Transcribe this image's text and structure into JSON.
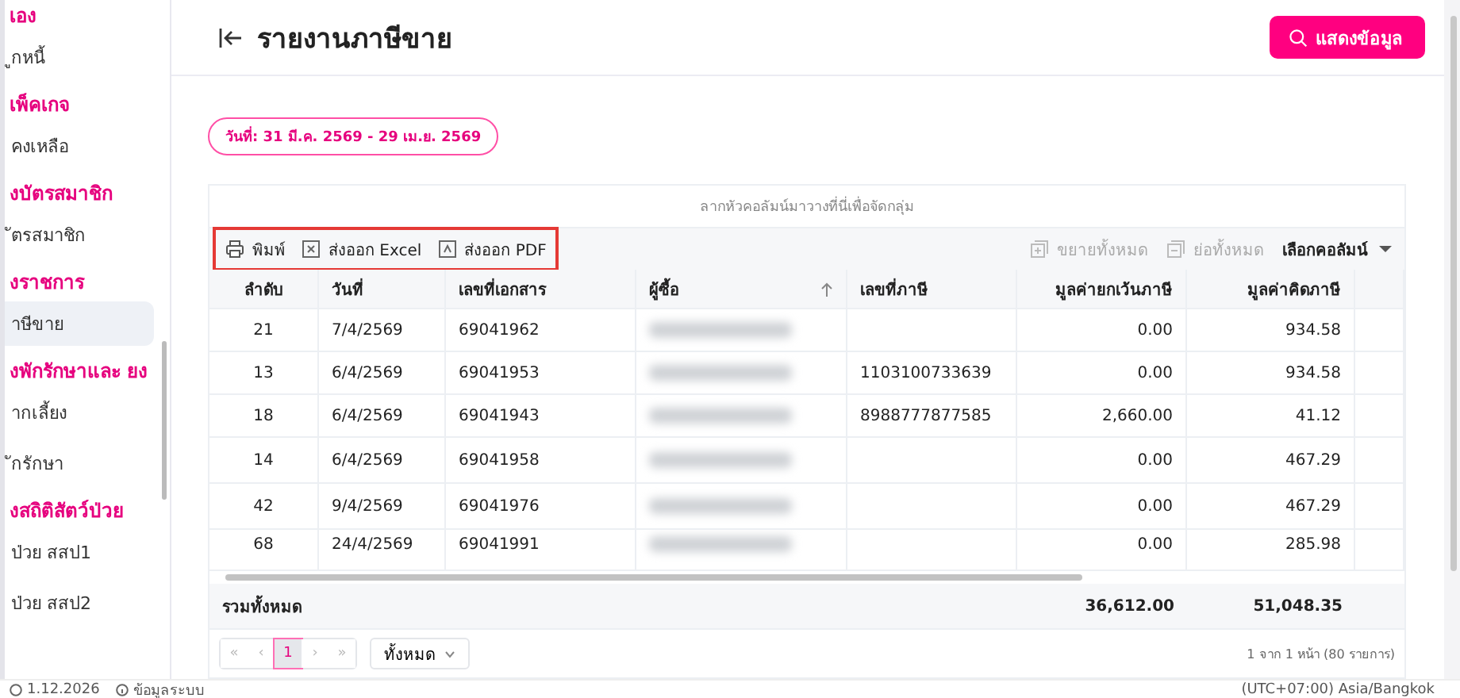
{
  "sidebar": {
    "sections": [
      {
        "title": "เอง",
        "items": [
          {
            "label": "ูกหนี้",
            "selected": false
          }
        ]
      },
      {
        "title": "เพ็คเกจ",
        "items": [
          {
            "label": "คงเหลือ",
            "selected": false
          }
        ]
      },
      {
        "title": "งบัตรสมาชิก",
        "items": [
          {
            "label": "ัตรสมาชิก",
            "selected": false
          }
        ]
      },
      {
        "title": "งราชการ",
        "items": [
          {
            "label": "าษีขาย",
            "selected": true
          }
        ]
      },
      {
        "title": "งพักรักษาและ ยง",
        "items": [
          {
            "label": "ากเลี้ยง",
            "selected": false
          },
          {
            "label": "ักรักษา",
            "selected": false
          }
        ]
      },
      {
        "title": "งสถิติสัตว์ป่วย",
        "items": [
          {
            "label": "ป่วย สสป1",
            "selected": false
          },
          {
            "label": "ป่วย สสป2",
            "selected": false
          }
        ]
      }
    ]
  },
  "header": {
    "title": "รายงานภาษีขาย",
    "button": "แสดงข้อมูล"
  },
  "date_range": "วันที่: 31 มี.ค. 2569 - 29 เม.ย. 2569",
  "grid": {
    "group_hint": "ลากหัวคอลัมน์มาวางที่นี่เพื่อจัดกลุ่ม",
    "toolbar": {
      "highlighted": true,
      "left": [
        {
          "label": "พิมพ์",
          "kind": "print"
        },
        {
          "label": "ส่งออก Excel",
          "kind": "excel"
        },
        {
          "label": "ส่งออก PDF",
          "kind": "pdf"
        }
      ],
      "right": [
        {
          "label": "ขยายทั้งหมด",
          "kind": "expand",
          "disabled": true
        },
        {
          "label": "ย่อทั้งหมด",
          "kind": "collapse",
          "disabled": true
        },
        {
          "label": "เลือกคอลัมน์",
          "kind": "columns",
          "disabled": false
        }
      ]
    },
    "columns": [
      {
        "label": "ลำดับ",
        "sorted": false
      },
      {
        "label": "วันที่",
        "sorted": false
      },
      {
        "label": "เลขที่เอกสาร",
        "sorted": false
      },
      {
        "label": "ผู้ซื้อ",
        "sorted": true
      },
      {
        "label": "เลขที่ภาษี",
        "sorted": false
      },
      {
        "label": "มูลค่ายกเว้นภาษี",
        "sorted": false
      },
      {
        "label": "มูลค่าคิดภาษี",
        "sorted": false
      }
    ],
    "rows": [
      {
        "cells": [
          "21",
          "7/4/2569",
          "69041962",
          "",
          "",
          "0.00",
          "934.58"
        ],
        "buyer_redacted": true
      },
      {
        "cells": [
          "13",
          "6/4/2569",
          "69041953",
          "",
          "1103100733639",
          "0.00",
          "934.58"
        ],
        "buyer_redacted": true
      },
      {
        "cells": [
          "18",
          "6/4/2569",
          "69041943",
          "",
          "8988777877585",
          "2,660.00",
          "41.12"
        ],
        "buyer_redacted": true
      },
      {
        "cells": [
          "14",
          "6/4/2569",
          "69041958",
          "",
          "",
          "0.00",
          "467.29"
        ],
        "buyer_redacted": true
      },
      {
        "cells": [
          "42",
          "9/4/2569",
          "69041976",
          "",
          "",
          "0.00",
          "467.29"
        ],
        "buyer_redacted": true
      },
      {
        "cells": [
          "68",
          "24/4/2569",
          "69041991",
          "",
          "",
          "0.00",
          "285.98"
        ],
        "buyer_redacted": true
      }
    ],
    "total": {
      "label": "รวมทั้งหมด",
      "exempt": "36,612.00",
      "taxable": "51,048.35"
    },
    "pager": {
      "first": "«",
      "prev": "‹",
      "pages": [
        {
          "label": "1",
          "selected": true
        }
      ],
      "next": "›",
      "last": "»",
      "size": "ทั้งหมด",
      "info": "1 จาก 1 หน้า (80 รายการ)"
    }
  },
  "status_bar": {
    "version": "1.12.2026",
    "info": "ข้อมูลระบบ",
    "timezone": "(UTC+07:00) Asia/Bangkok"
  }
}
